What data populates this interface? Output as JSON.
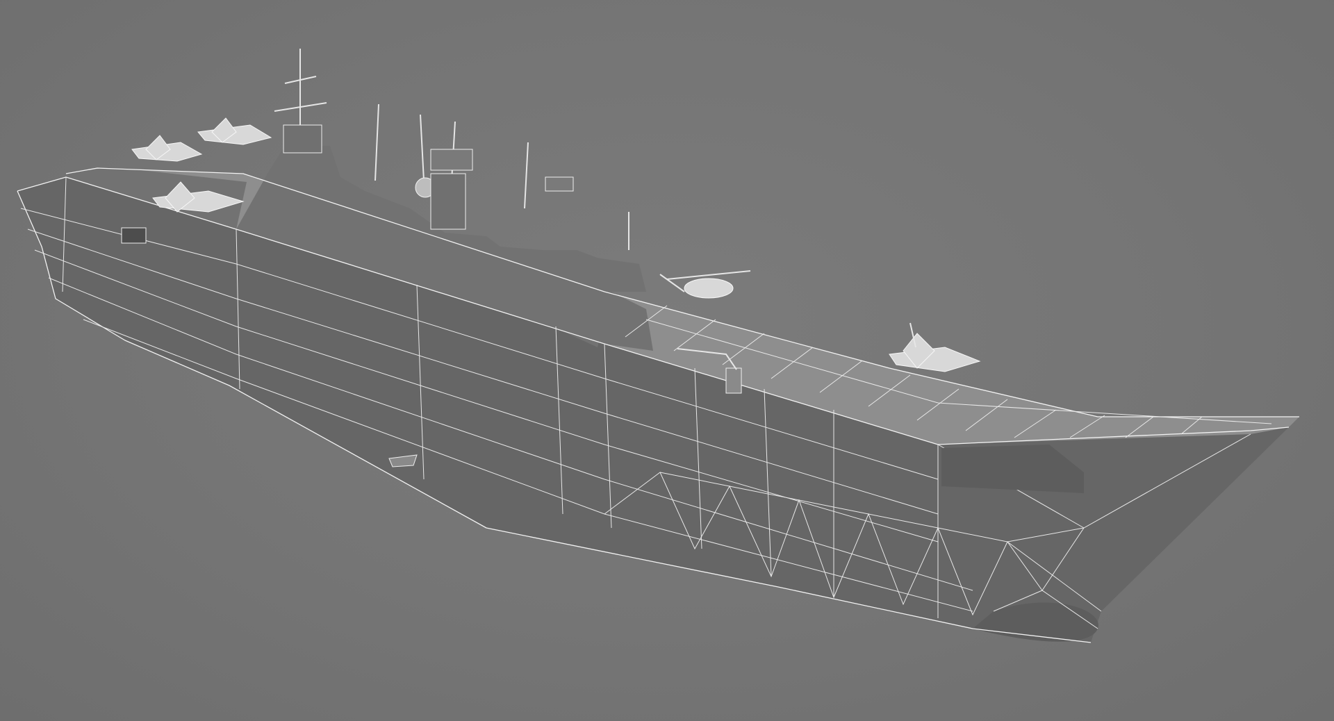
{
  "scene": {
    "subject": "",
    "background_color": "#757575",
    "wire_color": "#f2f2f2",
    "hull_color": "#666666",
    "deck_color": "#8e8e8e"
  }
}
